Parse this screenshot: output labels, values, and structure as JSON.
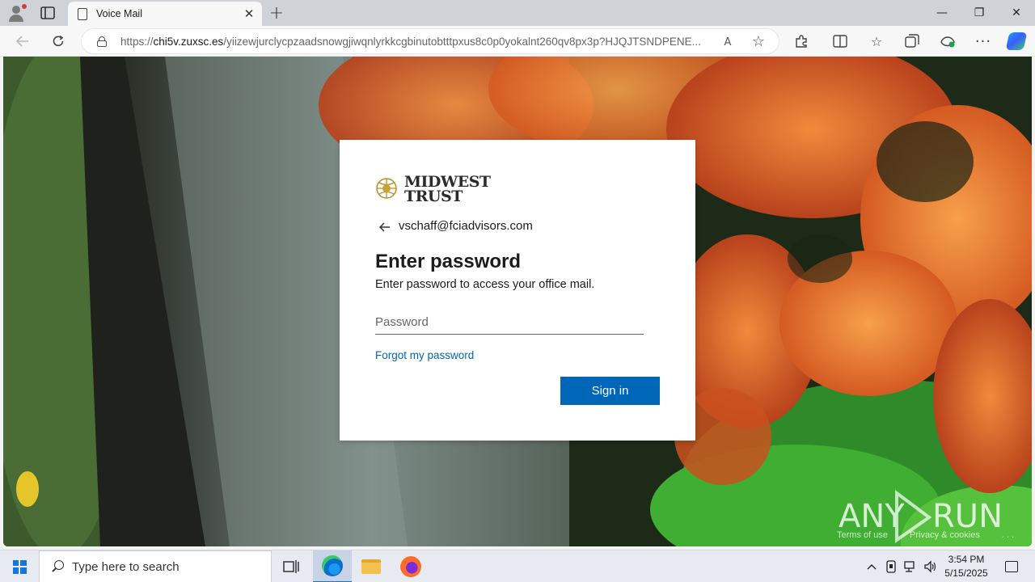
{
  "browser": {
    "tab": {
      "title": "Voice Mail",
      "close_glyph": "✕"
    },
    "new_tab_glyph": "+",
    "window_controls": {
      "minimize": "—",
      "maximize": "❐",
      "close": "✕"
    },
    "address": {
      "scheme": "https://",
      "host": "chi5v.zuxsc.es",
      "path": "/yiizewjurclycpzaadsnowgjiwqnlyrkkcgbinutobtttpxus8c0p0yokalnt260qv8px3p?HJQJTSNDPENE..."
    },
    "read_aloud_label": "A",
    "more_glyph": "···"
  },
  "page": {
    "logo": {
      "line1": "MIDWEST",
      "line2": "TRUST"
    },
    "email": "vschaff@fciadvisors.com",
    "heading": "Enter password",
    "subtext": "Enter password to access your office mail.",
    "password_placeholder": "Password",
    "forgot_link": "Forgot my password",
    "signin_label": "Sign in",
    "footer": {
      "terms": "Terms of use",
      "privacy": "Privacy & cookies",
      "more": ". . ."
    },
    "watermark": "ANY RUN"
  },
  "taskbar": {
    "search_placeholder": "Type here to search",
    "time": "3:54 PM",
    "date": "5/15/2025"
  },
  "colors": {
    "accent": "#0067b8",
    "edge_blue": "#1a73d9"
  }
}
